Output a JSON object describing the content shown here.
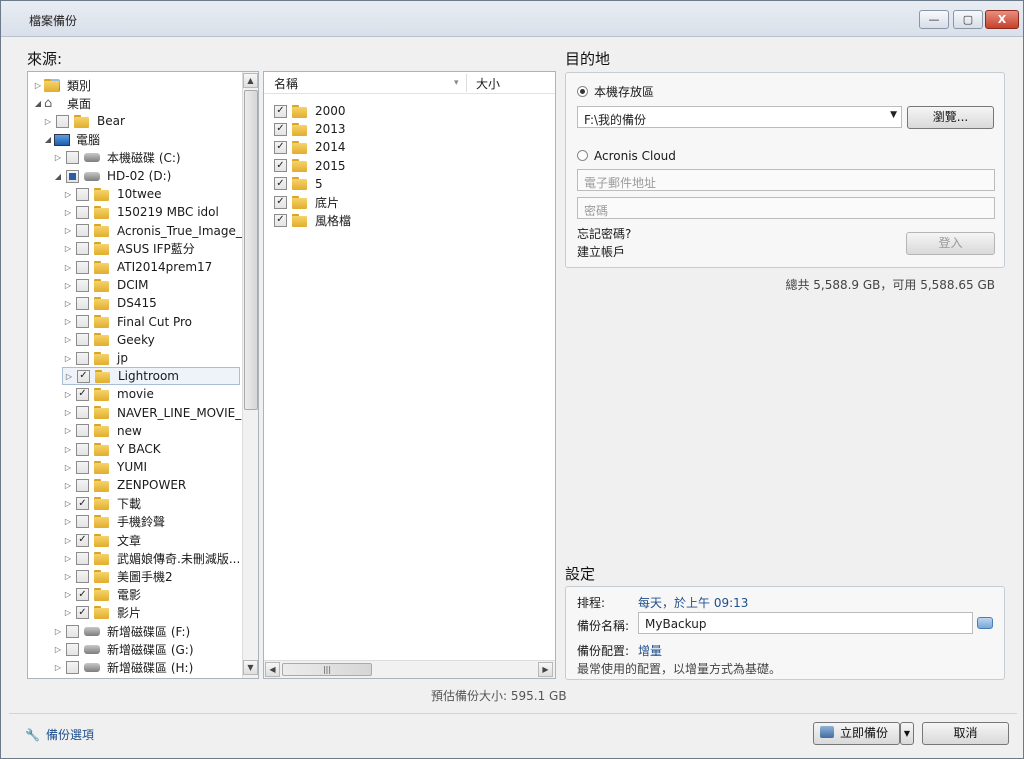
{
  "window": {
    "title": "檔案備份",
    "minimize": "—",
    "maximize": "▢",
    "close": "X"
  },
  "source": {
    "heading": "來源:",
    "tree": [
      {
        "label": "類別",
        "indent": 0,
        "arrow": "▷",
        "check": null,
        "icon": "category-icon"
      },
      {
        "label": "桌面",
        "indent": 0,
        "arrow": "◢",
        "check": null,
        "icon": "home-icon"
      },
      {
        "label": "Bear",
        "indent": 1,
        "arrow": "▷",
        "check": "none",
        "icon": "folder-icon"
      },
      {
        "label": "電腦",
        "indent": 1,
        "arrow": "◢",
        "check": null,
        "icon": "computer-icon"
      },
      {
        "label": "本機磁碟 (C:)",
        "indent": 2,
        "arrow": "▷",
        "check": "none",
        "icon": "drive-icon"
      },
      {
        "label": "HD-02 (D:)",
        "indent": 2,
        "arrow": "◢",
        "check": "partial",
        "icon": "drive-icon"
      },
      {
        "label": "10twee",
        "indent": 3,
        "arrow": "▷",
        "check": "none",
        "icon": "folder-icon"
      },
      {
        "label": "150219 MBC idol",
        "indent": 3,
        "arrow": "▷",
        "check": "none",
        "icon": "folder-icon"
      },
      {
        "label": "Acronis_True_Image_...",
        "indent": 3,
        "arrow": "▷",
        "check": "none",
        "icon": "folder-icon"
      },
      {
        "label": "ASUS IFP藍分",
        "indent": 3,
        "arrow": "▷",
        "check": "none",
        "icon": "folder-icon"
      },
      {
        "label": "ATI2014prem17",
        "indent": 3,
        "arrow": "▷",
        "check": "none",
        "icon": "folder-icon"
      },
      {
        "label": "DCIM",
        "indent": 3,
        "arrow": "▷",
        "check": "none",
        "icon": "folder-icon"
      },
      {
        "label": "DS415",
        "indent": 3,
        "arrow": "▷",
        "check": "none",
        "icon": "folder-icon"
      },
      {
        "label": "Final Cut Pro",
        "indent": 3,
        "arrow": "▷",
        "check": "none",
        "icon": "folder-icon"
      },
      {
        "label": "Geeky",
        "indent": 3,
        "arrow": "▷",
        "check": "none",
        "icon": "folder-icon"
      },
      {
        "label": "jp",
        "indent": 3,
        "arrow": "▷",
        "check": "none",
        "icon": "folder-icon"
      },
      {
        "label": "Lightroom",
        "indent": 3,
        "arrow": "▷",
        "check": "checked",
        "icon": "folder-icon",
        "selected": true
      },
      {
        "label": "movie",
        "indent": 3,
        "arrow": "▷",
        "check": "checked",
        "icon": "folder-icon"
      },
      {
        "label": "NAVER_LINE_MOVIE_F",
        "indent": 3,
        "arrow": "▷",
        "check": "none",
        "icon": "folder-icon"
      },
      {
        "label": "new",
        "indent": 3,
        "arrow": "▷",
        "check": "none",
        "icon": "folder-icon"
      },
      {
        "label": "Y BACK",
        "indent": 3,
        "arrow": "▷",
        "check": "none",
        "icon": "folder-icon"
      },
      {
        "label": "YUMI",
        "indent": 3,
        "arrow": "▷",
        "check": "none",
        "icon": "folder-icon"
      },
      {
        "label": "ZENPOWER",
        "indent": 3,
        "arrow": "▷",
        "check": "none",
        "icon": "folder-icon"
      },
      {
        "label": "下載",
        "indent": 3,
        "arrow": "▷",
        "check": "checked",
        "icon": "folder-icon"
      },
      {
        "label": "手機鈴聲",
        "indent": 3,
        "arrow": "▷",
        "check": "none",
        "icon": "folder-icon"
      },
      {
        "label": "文章",
        "indent": 3,
        "arrow": "▷",
        "check": "checked",
        "icon": "folder-icon"
      },
      {
        "label": "武媚娘傳奇.未刪減版...",
        "indent": 3,
        "arrow": "▷",
        "check": "none",
        "icon": "folder-icon"
      },
      {
        "label": "美圖手機2",
        "indent": 3,
        "arrow": "▷",
        "check": "none",
        "icon": "folder-icon"
      },
      {
        "label": "電影",
        "indent": 3,
        "arrow": "▷",
        "check": "checked",
        "icon": "folder-icon"
      },
      {
        "label": "影片",
        "indent": 3,
        "arrow": "▷",
        "check": "checked",
        "icon": "folder-icon"
      },
      {
        "label": "新增磁碟區 (F:)",
        "indent": 2,
        "arrow": "▷",
        "check": "none",
        "icon": "drive-icon"
      },
      {
        "label": "新增磁碟區 (G:)",
        "indent": 2,
        "arrow": "▷",
        "check": "none",
        "icon": "drive-icon"
      },
      {
        "label": "新增磁碟區 (H:)",
        "indent": 2,
        "arrow": "▷",
        "check": "none",
        "icon": "drive-icon"
      }
    ],
    "columns": {
      "name": "名稱",
      "size": "大小"
    },
    "files": [
      {
        "label": "2000",
        "check": "checked"
      },
      {
        "label": "2013",
        "check": "checked"
      },
      {
        "label": "2014",
        "check": "checked"
      },
      {
        "label": "2015",
        "check": "checked"
      },
      {
        "label": "5",
        "check": "checked"
      },
      {
        "label": "底片",
        "check": "checked"
      },
      {
        "label": "風格檔",
        "check": "checked"
      }
    ],
    "estimate": "預估備份大小: 595.1 GB"
  },
  "destination": {
    "heading": "目的地",
    "local_label": "本機存放區",
    "local_path": "F:\\我的備份",
    "browse": "瀏覽...",
    "cloud_label": "Acronis Cloud",
    "email_placeholder": "電子郵件地址",
    "password_placeholder": "密碼",
    "forgot": "忘記密碼?",
    "create": "建立帳戶",
    "login": "登入",
    "capacity": "總共 5,588.9 GB，可用 5,588.65 GB"
  },
  "settings": {
    "heading": "設定",
    "schedule_label": "排程:",
    "schedule_value": "每天，於上午 09:13",
    "name_label": "備份名稱:",
    "name_value": "MyBackup",
    "scheme_label": "備份配置:",
    "scheme_value": "增量",
    "scheme_desc": "最常使用的配置，以增量方式為基礎。"
  },
  "footer": {
    "options": "備份選項",
    "backup_now": "立即備份",
    "cancel": "取消"
  },
  "colors": {
    "link": "#1f4e8c",
    "accent": "#2a5ca8"
  }
}
